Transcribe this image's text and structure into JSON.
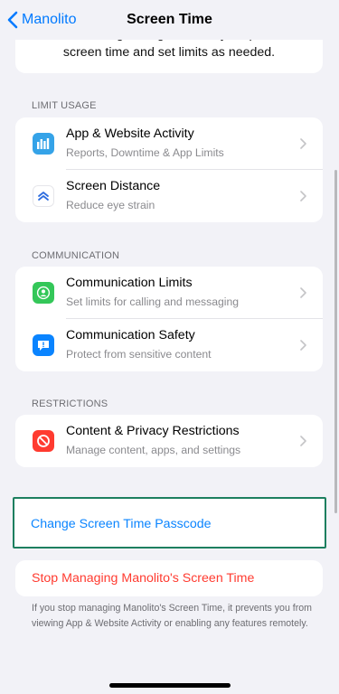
{
  "nav": {
    "back_label": "Manolito",
    "title": "Screen Time"
  },
  "intro": {
    "line1": "You can also get insights about your personal",
    "line2": "screen time and set limits as needed."
  },
  "sections": {
    "limit_usage": {
      "header": "LIMIT USAGE",
      "items": [
        {
          "title": "App & Website Activity",
          "subtitle": "Reports, Downtime & App Limits",
          "icon": "chart-icon",
          "color": "#35a3e8"
        },
        {
          "title": "Screen Distance",
          "subtitle": "Reduce eye strain",
          "icon": "screen-distance-icon",
          "color": "#2d6cdf"
        }
      ]
    },
    "communication": {
      "header": "COMMUNICATION",
      "items": [
        {
          "title": "Communication Limits",
          "subtitle": "Set limits for calling and messaging",
          "icon": "person-icon",
          "color": "#34c759"
        },
        {
          "title": "Communication Safety",
          "subtitle": "Protect from sensitive content",
          "icon": "chat-bubble-icon",
          "color": "#0a84ff"
        }
      ]
    },
    "restrictions": {
      "header": "RESTRICTIONS",
      "items": [
        {
          "title": "Content & Privacy Restrictions",
          "subtitle": "Manage content, apps, and settings",
          "icon": "no-entry-icon",
          "color": "#ff3b30"
        }
      ]
    }
  },
  "actions": {
    "change_passcode": "Change Screen Time Passcode",
    "stop_managing": "Stop Managing Manolito's Screen Time"
  },
  "footnote": "If you stop managing Manolito's Screen Time, it prevents you from viewing App & Website Activity or enabling any features remotely.",
  "colors": {
    "accent": "#007aff",
    "destructive": "#ff3b30",
    "highlight_border": "#1d7f5f"
  }
}
